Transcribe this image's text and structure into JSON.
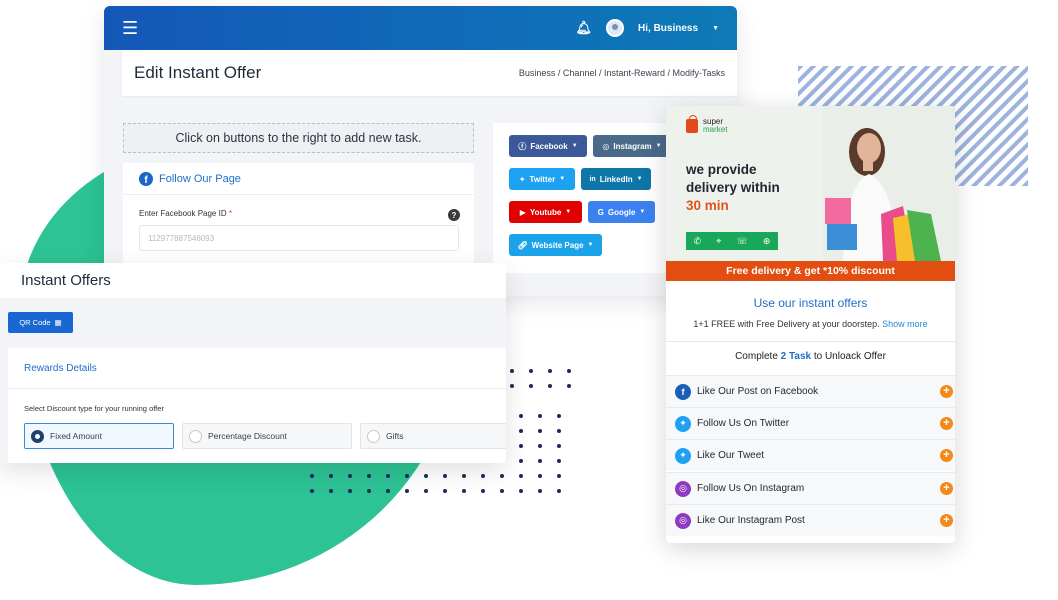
{
  "editor": {
    "user_greeting": "Hi, Business",
    "page_title": "Edit Instant Offer",
    "breadcrumb": "Business / Channel / Instant-Reward / Modify-Tasks",
    "task_hint": "Click on buttons to the right to add new task.",
    "facebook_card": {
      "title": "Follow Our Page",
      "field_label": "Enter Facebook Page ID",
      "required_mark": "*",
      "field_value": "112977887546093",
      "help_icon": "question-circle-icon"
    },
    "social_buttons": [
      {
        "label": "Facebook",
        "icon": "facebook-icon",
        "color": "#3b5998"
      },
      {
        "label": "Instagram",
        "icon": "instagram-icon",
        "color": "#4a6a8a"
      },
      {
        "label": "Twitter",
        "icon": "twitter-icon",
        "color": "#1da1f2"
      },
      {
        "label": "LinkedIn",
        "icon": "linkedin-icon",
        "color": "#0e76a8"
      },
      {
        "label": "Youtube",
        "icon": "youtube-icon",
        "color": "#e00000"
      },
      {
        "label": "Google",
        "icon": "google-icon",
        "color": "#3b82f0"
      },
      {
        "label": "Website Page",
        "icon": "link-icon",
        "color": "#1aa3e8"
      }
    ]
  },
  "offers": {
    "title": "Instant Offers",
    "qr_button": "QR Code",
    "rewards_title": "Rewards Details",
    "discount_label": "Select Discount type for your running offer",
    "options": [
      {
        "label": "Fixed Amount",
        "selected": true
      },
      {
        "label": "Percentage Discount",
        "selected": false
      },
      {
        "label": "Gifts",
        "selected": false
      }
    ]
  },
  "preview": {
    "brand_top": "super",
    "brand_bottom": "market",
    "hero_line1": "we provide",
    "hero_line2": "delivery within",
    "hero_time": "30 min",
    "promo_banner": "Free delivery & get *10% discount",
    "use_title": "Use our instant offers",
    "use_sub": "1+1 FREE with Free Delivery at your doorstep.",
    "show_more": "Show more",
    "complete_prefix": "Complete",
    "complete_count": "2 Task",
    "complete_suffix": "to Unloack Offer",
    "tasks": [
      {
        "label": "Like Our Post on Facebook",
        "icon": "facebook-icon",
        "color": "#1a5fb4"
      },
      {
        "label": "Follow Us On Twitter",
        "icon": "twitter-icon",
        "color": "#1da1f2"
      },
      {
        "label": "Like Our Tweet",
        "icon": "twitter-icon",
        "color": "#1da1f2"
      },
      {
        "label": "Follow Us On Instagram",
        "icon": "instagram-icon",
        "color": "#8e3bbf"
      },
      {
        "label": "Like Our Instagram Post",
        "icon": "instagram-icon",
        "color": "#8e3bbf"
      }
    ]
  },
  "colors": {
    "topbar": "#1457b8",
    "accent_blue": "#1f6fc8",
    "green": "#2dc394",
    "orange": "#e24d12"
  }
}
